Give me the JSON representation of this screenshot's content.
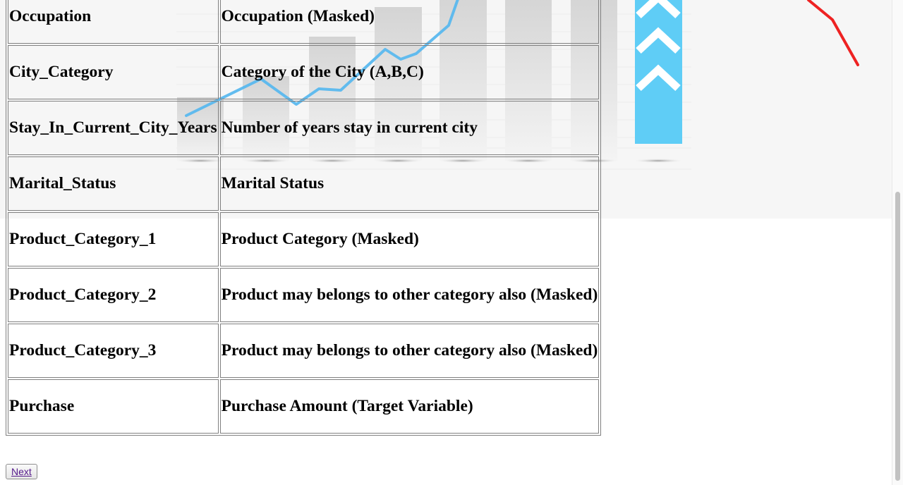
{
  "table": {
    "rows": [
      {
        "name": "Occupation",
        "description": "Occupation (Masked)"
      },
      {
        "name": "City_Category",
        "description": "Category of the City (A,B,C)"
      },
      {
        "name": "Stay_In_Current_City_Years",
        "description": "Number of years stay in current city"
      },
      {
        "name": "Marital_Status",
        "description": "Marital Status"
      },
      {
        "name": "Product_Category_1",
        "description": "Product Category (Masked)"
      },
      {
        "name": "Product_Category_2",
        "description": "Product may belongs to other category also (Masked)"
      },
      {
        "name": "Product_Category_3",
        "description": "Product may belongs to other category also (Masked)"
      },
      {
        "name": "Purchase",
        "description": "Purchase Amount (Target Variable)"
      }
    ]
  },
  "next_button": {
    "label": "Next"
  },
  "colors": {
    "link": "#551a8b",
    "bg_line": "#5ab8ee",
    "bg_arrow": "#5fcdf6",
    "bg_red_line": "#ee2222",
    "table_border": "#808080"
  }
}
